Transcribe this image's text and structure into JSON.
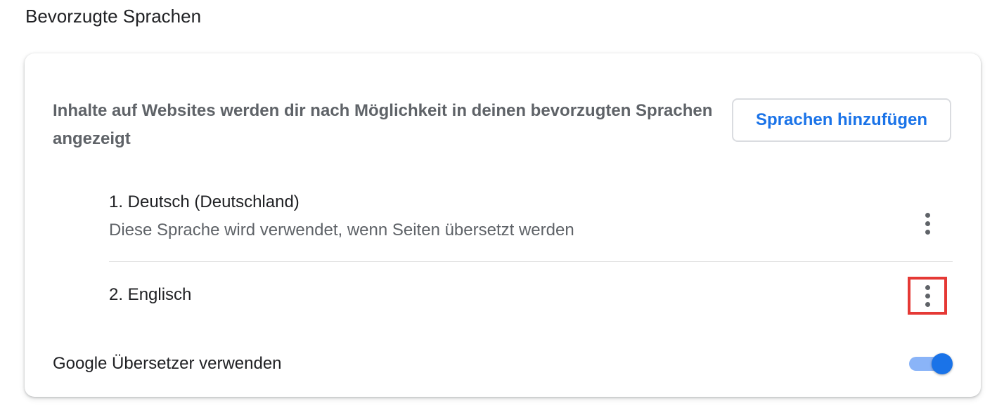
{
  "section": {
    "title": "Bevorzugte Sprachen"
  },
  "card": {
    "description": "Inhalte auf Websites werden dir nach Möglichkeit in deinen bevorzugten Sprachen angezeigt",
    "add_button_label": "Sprachen hinzufügen",
    "languages": [
      {
        "label": "1. Deutsch (Deutschland)",
        "subtitle": "Diese Sprache wird verwendet, wenn Seiten übersetzt werden",
        "menu_icon": "more-vert-icon"
      },
      {
        "label": "2. Englisch",
        "menu_icon": "more-vert-icon",
        "highlighted": true
      }
    ],
    "translate": {
      "label": "Google Übersetzer verwenden",
      "enabled": true
    }
  },
  "colors": {
    "accent": "#1a73e8",
    "toggle_track": "#8ab4f8",
    "highlight_border": "#e53935",
    "secondary_text": "#5f6368",
    "primary_text": "#202124"
  }
}
